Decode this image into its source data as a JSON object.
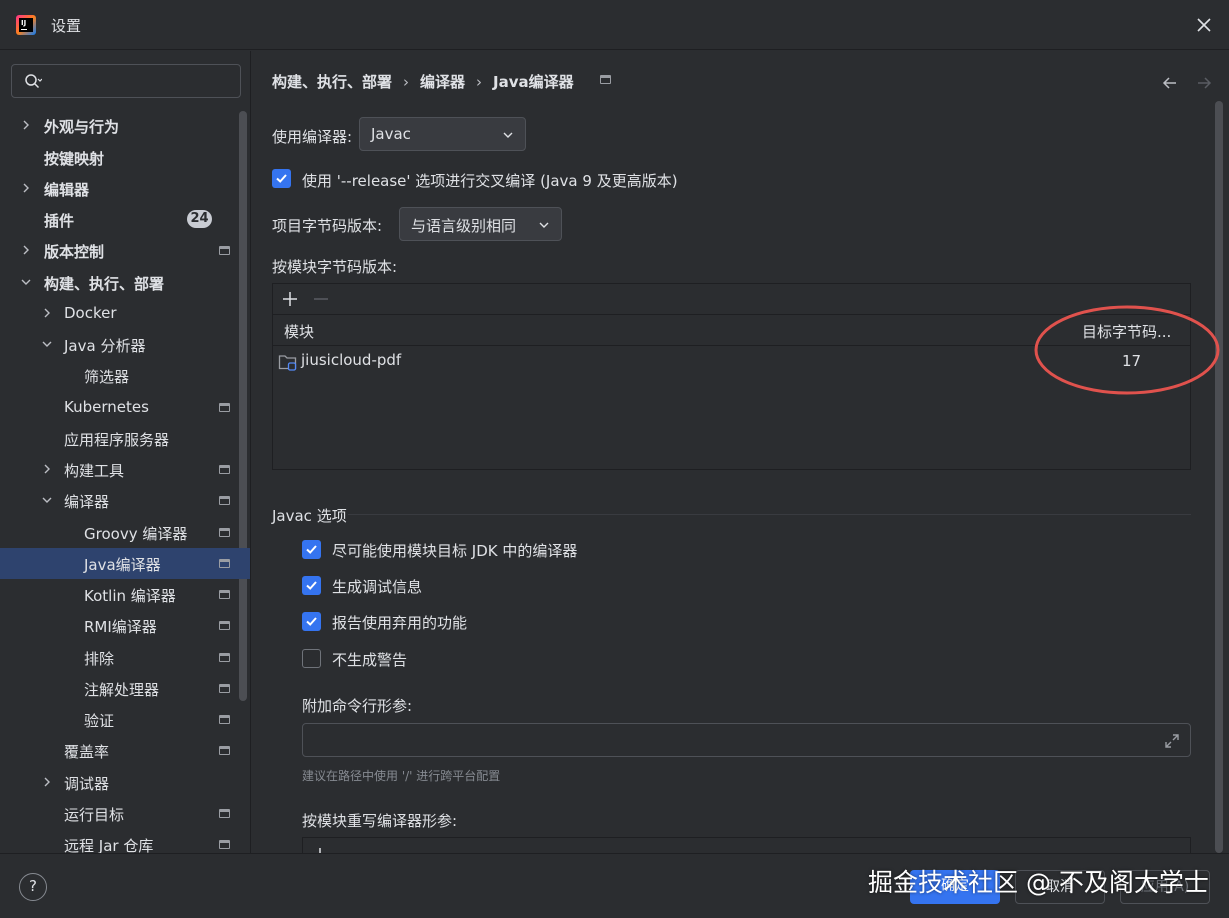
{
  "window": {
    "title": "设置"
  },
  "search": {
    "placeholder": ""
  },
  "sidebar": {
    "items": [
      {
        "label": "外观与行为",
        "bold": true
      },
      {
        "label": "按键映射",
        "bold": true
      },
      {
        "label": "编辑器",
        "bold": true
      },
      {
        "label": "插件",
        "bold": true,
        "badge": "24"
      },
      {
        "label": "版本控制",
        "bold": true
      },
      {
        "label": "构建、执行、部署",
        "bold": true
      },
      {
        "label": "Docker"
      },
      {
        "label": "Java 分析器"
      },
      {
        "label": "筛选器"
      },
      {
        "label": "Kubernetes"
      },
      {
        "label": "应用程序服务器"
      },
      {
        "label": "构建工具"
      },
      {
        "label": "编译器"
      },
      {
        "label": "Groovy 编译器"
      },
      {
        "label": "Java编译器"
      },
      {
        "label": "Kotlin 编译器"
      },
      {
        "label": "RMI编译器"
      },
      {
        "label": "排除"
      },
      {
        "label": "注解处理器"
      },
      {
        "label": "验证"
      },
      {
        "label": "覆盖率"
      },
      {
        "label": "调试器"
      },
      {
        "label": "运行目标"
      },
      {
        "label": "远程 Jar 仓库"
      }
    ]
  },
  "breadcrumb": {
    "items": [
      "构建、执行、部署",
      "编译器",
      "Java编译器"
    ],
    "separator": "›"
  },
  "compiler": {
    "use_compiler_label": "使用编译器:",
    "use_compiler_value": "Javac",
    "release_option_label": "使用 '--release' 选项进行交叉编译 (Java 9 及更高版本)",
    "release_option_checked": true,
    "project_bytecode_label": "项目字节码版本:",
    "project_bytecode_value": "与语言级别相同",
    "per_module_label": "按模块字节码版本:"
  },
  "module_table": {
    "columns": [
      "模块",
      "目标字节码..."
    ],
    "rows": [
      {
        "module": "jiusicloud-pdf",
        "target": "17"
      }
    ]
  },
  "javac": {
    "section_title": "Javac 选项",
    "options": [
      {
        "label": "尽可能使用模块目标 JDK 中的编译器",
        "checked": true
      },
      {
        "label": "生成调试信息",
        "checked": true
      },
      {
        "label": "报告使用弃用的功能",
        "checked": true
      },
      {
        "label": "不生成警告",
        "checked": false
      }
    ],
    "extra_args_label": "附加命令行形参:",
    "extra_args_value": "",
    "extra_args_hint": "建议在路径中使用 '/' 进行跨平台配置",
    "override_label": "按模块重写编译器形参:"
  },
  "footer": {
    "help": "?",
    "ok": "确定",
    "cancel": "取消",
    "apply": "应用(A)"
  },
  "watermark": "掘金技术社区 @ 不及阁大学士",
  "colors": {
    "accent": "#3574f0",
    "selection": "#2e436e",
    "annotation": "#e0524d",
    "background": "#2b2d30"
  }
}
